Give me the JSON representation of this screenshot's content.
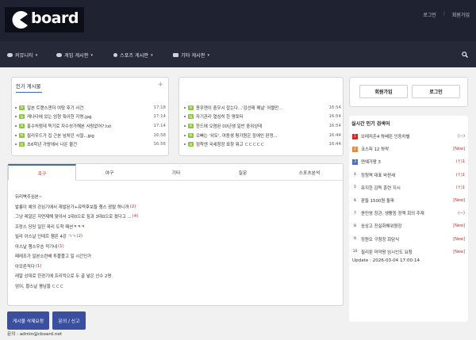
{
  "header": {
    "brand": "board",
    "links": [
      "로그인",
      "회원가입"
    ],
    "nav": [
      {
        "label": "커뮤니티",
        "icon": "community-icon"
      },
      {
        "label": "게임 게시판",
        "icon": "gamepad-icon"
      },
      {
        "label": "스포츠 게시판",
        "icon": "ball-icon"
      },
      {
        "label": "기타 게시판",
        "icon": "etc-icon"
      }
    ]
  },
  "popular": {
    "title": "인기 게시물",
    "plus": "+",
    "badge": "N",
    "items": [
      {
        "title": "일본 트랜스젠더 여탕 후기 사건",
        "time": "17:18"
      },
      {
        "title": "캐나다에 있는 엄청 특이한 지명.jpg",
        "time": "17:14"
      },
      {
        "title": "홍수처럼데 독기로 자수성가해본 사람없어?.txt",
        "time": "17:14"
      },
      {
        "title": "필리우드가 집 근본 넘치던 시절...jpg",
        "time": "16:58"
      },
      {
        "title": "초6학년 가방에서 나온 물건",
        "time": "16:56"
      }
    ]
  },
  "popular2": {
    "badge": "N",
    "items": [
      {
        "title": "종우엔이 중우시 잡는다...'김선태 페널' 어쩔만...",
        "time": "16:54"
      },
      {
        "title": "자기관리 열심히 한 명포터",
        "time": "16:54"
      },
      {
        "title": "한드에 오염된 00년생 일반 중위상태",
        "time": "16:54"
      },
      {
        "title": "오빠는 '위도', 여동생 평가원은 장애인 판정...",
        "time": "16:44"
      },
      {
        "title": "점착엔 국세청장 표창 뭐고 ㄷㄷㄷㄷㄷ",
        "time": "16:44"
      }
    ]
  },
  "auth": {
    "signup": "회원가입",
    "login": "로그인"
  },
  "realtime": {
    "title": "실시간 인기 검색어",
    "items": [
      {
        "rank": "1",
        "keyword": "브레저존4 하베린 인증차별",
        "change": "(—)"
      },
      {
        "rank": "2",
        "keyword": "코스피 12 하락",
        "change": "[New]"
      },
      {
        "rank": "3",
        "keyword": "연예가왕 3",
        "change": "(↑)1"
      },
      {
        "rank": "4",
        "keyword": "정청역 대표 바뀐세",
        "change": "(↑)1"
      },
      {
        "rank": "5",
        "keyword": "유지한 감독 훈련 지시",
        "change": "(↑)1"
      },
      {
        "rank": "6",
        "keyword": "판들 1500원 돌파",
        "change": "[New]"
      },
      {
        "rank": "7",
        "keyword": "윤민영 장관, 생활등 정책 회의 주재",
        "change": "(—)"
      },
      {
        "rank": "8",
        "keyword": "송상고 진실화해위원장",
        "change": "[New]"
      },
      {
        "rank": "9",
        "keyword": "정원오 구청장 회담식",
        "change": "[New]"
      },
      {
        "rank": "10",
        "keyword": "필리핀 마약왕 임시인도 요청",
        "change": "[New]"
      }
    ],
    "update": "Update : 2026-03-04 17:00:14"
  },
  "board": {
    "tabs": [
      "축구",
      "야구",
      "기타",
      "질문",
      "스포츠분석"
    ],
    "posts": [
      {
        "title": "뒤리벽주심본~",
        "comments": ""
      },
      {
        "title": "발롱이 예의 강심기에서 재발된가+유력후보들 챔스 광탈 하니까",
        "comments": "(2)"
      },
      {
        "title": "그냥 레알은 자연재해 맞아서 1대0으로 짐과 3대0으로 졌다고 ...",
        "comments": "(4)"
      },
      {
        "title": "프랑스 당당 일진 파리 도착 패션ㅋㅋㅋ",
        "comments": ""
      },
      {
        "title": "빌라 아스날 인테르 챔픈 4강 ㄱㄱ",
        "comments": "(2)"
      },
      {
        "title": "아스날 챔스우승 적기네",
        "comments": "(1)"
      },
      {
        "title": "페레조가 일본소련배 투플플고 일 시간인가",
        "comments": ""
      },
      {
        "title": "아모른적다",
        "comments": "(1)"
      },
      {
        "title": "레알 상대로 한경기에 프리킥으로 두 골 넣은 선수 2명",
        "comments": ""
      },
      {
        "title": "엄이, 황스날 평남들 ㄷㄷㄷ",
        "comments": ""
      }
    ]
  },
  "footer": {
    "report_button": "게시물 삭제요청",
    "inquiry_button": "문의 / 신고",
    "contact": "문의 : admin@cboard.net"
  }
}
